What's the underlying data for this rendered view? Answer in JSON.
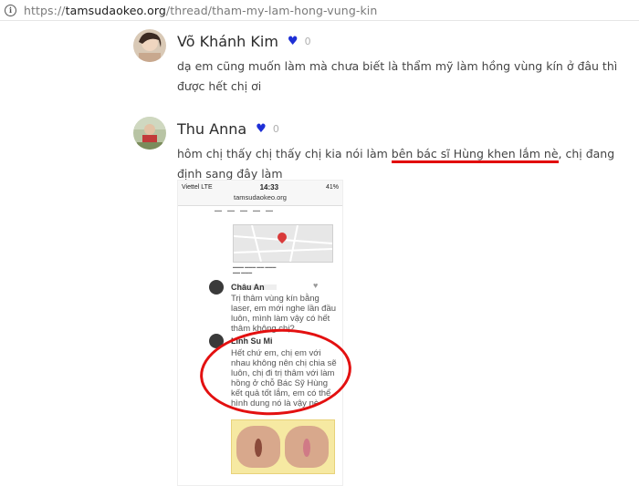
{
  "browser": {
    "url_scheme": "https://",
    "url_host": "tamsudaokeo.org",
    "url_path": "/thread/tham-my-lam-hong-vung-kin"
  },
  "posts": [
    {
      "author": "Võ Khánh Kim",
      "likes": "0",
      "text": "dạ em cũng muốn làm mà chưa biết là thẩm mỹ làm hồng vùng kín ở đâu thì được hết chị ơi"
    },
    {
      "author": "Thu Anna",
      "likes": "0",
      "text_before": "hôm chị thấy chị thấy chị kia nói làm ",
      "text_highlight": "bên bác sĩ Hùng khen lắm nè",
      "text_after": ", chị đang định sang đây làm"
    }
  ],
  "screenshot": {
    "carrier": "Viettel",
    "network": "LTE",
    "time": "14:33",
    "battery": "41%",
    "url": "tamsudaokeo.org",
    "comments": [
      {
        "author": "Châu An",
        "text": "Trị thâm vùng kín bằng laser, em mới nghe lần đầu luôn, mình làm vậy có hết thâm không chị?"
      },
      {
        "author": "Linh Su Mi",
        "text": "Hết chứ em, chị em với nhau không nên chị chia sẽ luôn, chị đi trị thâm với làm hồng ở chỗ Bác Sỹ Hùng kết quả tốt lắm, em có thể hình dung nó là vậy nè"
      }
    ]
  },
  "colors": {
    "heart": "#1e2fd6",
    "annotation_red": "#e31010"
  }
}
